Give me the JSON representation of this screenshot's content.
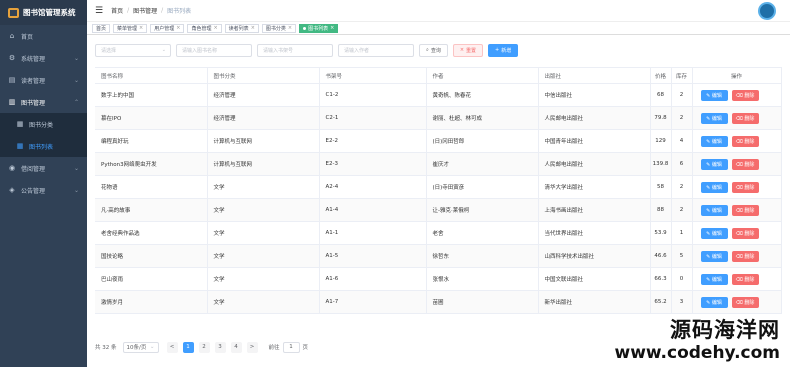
{
  "brand": {
    "title": "图书馆管理系统"
  },
  "sidebar": {
    "items": [
      {
        "label": "首页",
        "icon": "home-icon",
        "glyph": "⌂"
      },
      {
        "label": "系统管理",
        "icon": "gear-icon",
        "glyph": "⚙"
      },
      {
        "label": "读者管理",
        "icon": "reader-icon",
        "glyph": "▤"
      },
      {
        "label": "图书管理",
        "icon": "book-icon",
        "glyph": "▥"
      },
      {
        "label": "借阅管理",
        "icon": "borrow-icon",
        "glyph": "◉"
      },
      {
        "label": "公告管理",
        "icon": "notice-icon",
        "glyph": "◈"
      }
    ],
    "submenu": [
      {
        "label": "图书分类",
        "icon": "category-icon",
        "glyph": "▦"
      },
      {
        "label": "图书列表",
        "icon": "list-icon",
        "glyph": "▦"
      }
    ]
  },
  "breadcrumb": {
    "home": "首页",
    "section": "图书管理",
    "current": "图书列表"
  },
  "tags": [
    "首页",
    "菜单管理",
    "用户管理",
    "角色管理",
    "读者列表",
    "图书分类",
    "图书列表"
  ],
  "filters": {
    "select_placeholder": "请选择",
    "name_placeholder": "请输入图书名称",
    "code_placeholder": "请输入书架号",
    "author_placeholder": "请输入作者",
    "search_label": "查询",
    "reset_label": "重置",
    "add_label": "新增"
  },
  "table": {
    "columns": [
      "图书名称",
      "图书分类",
      "书架号",
      "作者",
      "出版社",
      "价格",
      "库存",
      "操作"
    ],
    "rows": [
      [
        "数字上的中国",
        "经济管理",
        "C1-2",
        "黄奇帆、陈春花",
        "中信出版社",
        "68",
        "2"
      ],
      [
        "慕在IPO",
        "经济管理",
        "C2-1",
        "谢丽、杜超、林可成",
        "人民邮电出版社",
        "79.8",
        "2"
      ],
      [
        "编程真好玩",
        "计算机与互联网",
        "E2-2",
        "(日)冈田哲郎",
        "中国青年出版社",
        "129",
        "4"
      ],
      [
        "Python3网络爬虫开发",
        "计算机与互联网",
        "E2-3",
        "崔庆才",
        "人民邮电出版社",
        "139.8",
        "6"
      ],
      [
        "花物语",
        "文学",
        "A2-4",
        "(日)寺田寅彦",
        "清华大学出版社",
        "58",
        "2"
      ],
      [
        "凡·高的故事",
        "文学",
        "A1-4",
        "让-雅克·莱俄柯",
        "上海书画出版社",
        "88",
        "2"
      ],
      [
        "老舍经典作品选",
        "文学",
        "A1-1",
        "老舍",
        "当代世界出版社",
        "53.9",
        "1"
      ],
      [
        "国技论略",
        "文学",
        "A1-5",
        "徐哲东",
        "山西科学技术出版社",
        "46.6",
        "5"
      ],
      [
        "巴山夜雨",
        "文学",
        "A1-6",
        "张恨水",
        "中国文联出版社",
        "66.3",
        "0"
      ],
      [
        "激情岁月",
        "文学",
        "A1-7",
        "苗圃",
        "新华出版社",
        "65.2",
        "3"
      ]
    ],
    "edit_label": "编辑",
    "delete_label": "删除"
  },
  "pagination": {
    "total_label": "共 32 条",
    "page_size": "10条/页",
    "prev": "<",
    "pages": [
      "1",
      "2",
      "3",
      "4"
    ],
    "next": ">",
    "goto_label": "前往",
    "goto_value": "1",
    "page_unit": "页"
  },
  "watermark": {
    "cn": "源码海洋网",
    "url": "www.codehy.com"
  },
  "colors": {
    "sidebar": "#304156",
    "primary": "#409eff",
    "danger": "#f56c6c",
    "active_tag": "#42b983"
  }
}
